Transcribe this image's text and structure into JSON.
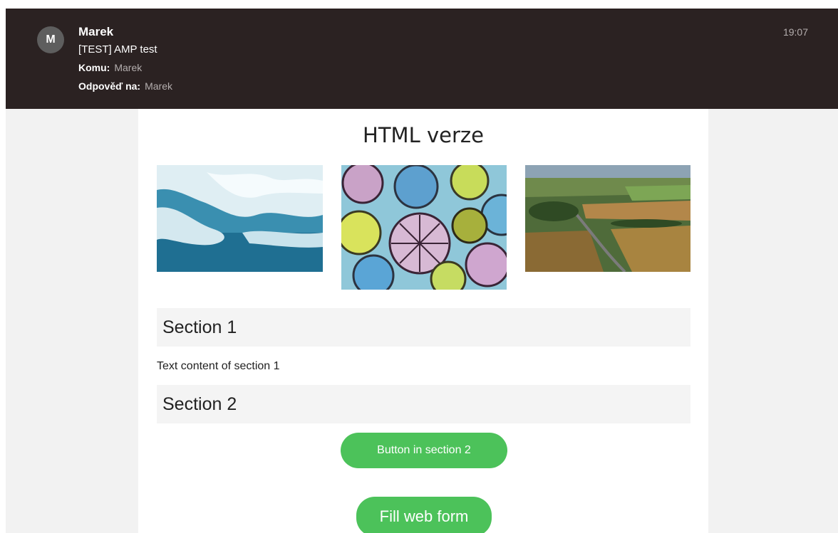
{
  "header": {
    "avatar_letter": "M",
    "sender": "Marek",
    "subject": "[TEST] AMP test",
    "to_label": "Komu:",
    "to_value": "Marek",
    "reply_label": "Odpověď na:",
    "reply_value": "Marek",
    "time": "19:07"
  },
  "email": {
    "title": "HTML verze",
    "images": [
      "ice-image",
      "floral-pattern-image",
      "aerial-fields-image"
    ],
    "section1": {
      "heading": "Section 1",
      "text": "Text content of section 1"
    },
    "section2": {
      "heading": "Section 2",
      "button_label": "Button in section 2"
    },
    "form_button_label": "Fill web form"
  },
  "colors": {
    "header_bg": "#2b2222",
    "accent_green": "#4cc25a",
    "page_bg": "#f2f2f2"
  }
}
